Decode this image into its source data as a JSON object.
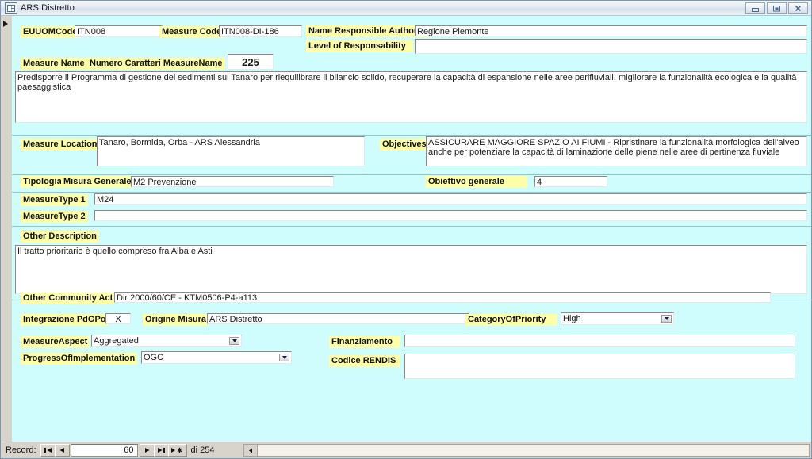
{
  "window": {
    "title": "ARS Distretto",
    "icon": "access-form-icon",
    "buttons": [
      {
        "name": "minimize-button",
        "glyph": "minimize-icon"
      },
      {
        "name": "restore-button",
        "glyph": "restore-icon"
      },
      {
        "name": "close-button",
        "glyph": "close-icon"
      }
    ]
  },
  "form": {
    "record_selector": "record-selector-arrow",
    "fields": {
      "euuom_code": {
        "label": "EUUOMCode",
        "value": "ITN008"
      },
      "measure_code": {
        "label": "Measure Code",
        "value": "ITN008-DI-186"
      },
      "name_responsible_authority": {
        "label": "Name Responsible Authority",
        "value": "Regione Piemonte"
      },
      "level_of_responsability": {
        "label": "Level of Responsability",
        "value": ""
      },
      "measure_name": {
        "label": "Measure Name",
        "value": "Predisporre il Programma di gestione dei sedimenti sul Tanaro per riequilibrare il bilancio solido, recuperare la capacità di espansione nelle aree perifluviali, migliorare la funzionalità ecologica e la qualità paesaggistica"
      },
      "numero_caratteri": {
        "label": "Numero Caratteri MeasureName",
        "value": "225"
      },
      "measure_location": {
        "label": "Measure Location",
        "value": "Tanaro, Bormida, Orba - ARS Alessandria"
      },
      "objectives": {
        "label": "Objectives",
        "value": "ASSICURARE MAGGIORE SPAZIO AI FIUMI - Ripristinare la funzionalità morfologica dell'alveo anche per potenziare la capacità di laminazione delle piene nelle aree di pertinenza fluviale"
      },
      "tipologia": {
        "label": "Tipologia",
        "label2": "Misura Generale",
        "value": "M2 Prevenzione"
      },
      "obiettivo_generale": {
        "label": "Obiettivo generale",
        "value": "4"
      },
      "measure_type_1": {
        "label": "MeasureType 1",
        "value": "M24"
      },
      "measure_type_2": {
        "label": "MeasureType 2",
        "value": ""
      },
      "other_description": {
        "label": "Other Description",
        "value": "Il tratto prioritario è quello compreso fra Alba e Asti"
      },
      "other_community_act": {
        "label": "Other Community Act",
        "value": "Dir 2000/60/CE - KTM0506-P4-a113"
      },
      "integrazione_pdgpo": {
        "label": "Integrazione PdGPo",
        "value": "X"
      },
      "origine_misura": {
        "label": "Origine Misura",
        "value": "ARS Distretto"
      },
      "category_of_priority": {
        "label": "CategoryOfPriority",
        "value": "High"
      },
      "measure_aspect": {
        "label": "MeasureAspect",
        "value": "Aggregated"
      },
      "progress_of_implementation": {
        "label": "ProgressOfImplementation",
        "value": "OGC"
      },
      "finanziamento": {
        "label": "Finanziamento",
        "value": ""
      },
      "codice_rendis": {
        "label": "Codice RENDIS",
        "value": ""
      }
    }
  },
  "statusbar": {
    "record_label": "Record:",
    "current_record": "60",
    "of_text": "di 254",
    "nav": [
      {
        "name": "first-record-button",
        "glyph": "first-icon"
      },
      {
        "name": "previous-record-button",
        "glyph": "previous-icon"
      },
      {
        "name": "next-record-button",
        "glyph": "next-icon"
      },
      {
        "name": "last-record-button",
        "glyph": "last-icon"
      },
      {
        "name": "new-record-button",
        "glyph": "new-record-icon"
      }
    ]
  },
  "colors": {
    "form_background": "#cffcfc",
    "label_highlight": "#ffffa8",
    "field_background": "#ffffff",
    "chrome": "#d8d4cb"
  }
}
